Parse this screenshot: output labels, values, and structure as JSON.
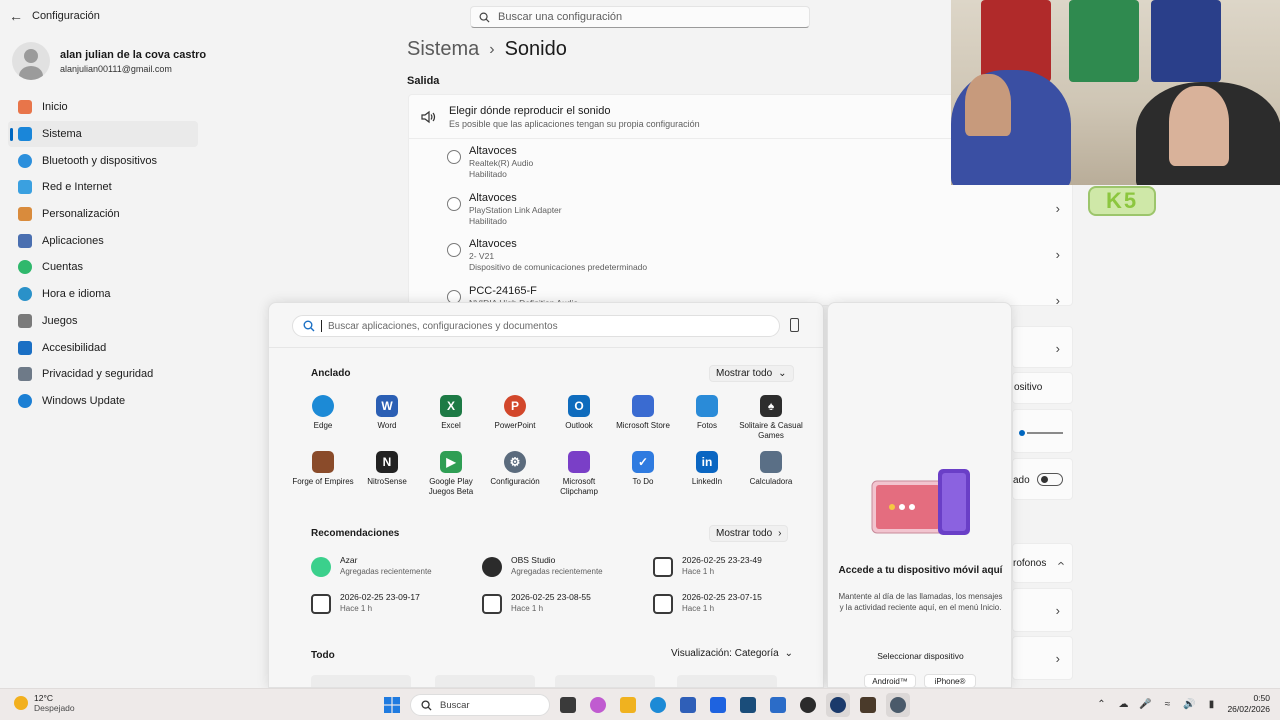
{
  "settings": {
    "app_title": "Configuración",
    "search_placeholder": "Buscar una configuración",
    "user": {
      "name": "alan julian de la cova castro",
      "email": "alanjulian00111@gmail.com"
    },
    "nav": [
      {
        "label": "Inicio",
        "icon": "home-icon",
        "color": "#e8754a"
      },
      {
        "label": "Sistema",
        "icon": "system-icon",
        "color": "#1a86d9"
      },
      {
        "label": "Bluetooth y dispositivos",
        "icon": "bluetooth-icon",
        "color": "#2b8fdc"
      },
      {
        "label": "Red e Internet",
        "icon": "network-icon",
        "color": "#3aa0e0"
      },
      {
        "label": "Personalización",
        "icon": "brush-icon",
        "color": "#d98b3c"
      },
      {
        "label": "Aplicaciones",
        "icon": "apps-icon",
        "color": "#4a6fb0"
      },
      {
        "label": "Cuentas",
        "icon": "account-icon",
        "color": "#2fb86c"
      },
      {
        "label": "Hora e idioma",
        "icon": "globe-icon",
        "color": "#2a91c9"
      },
      {
        "label": "Juegos",
        "icon": "gamepad-icon",
        "color": "#7a7a7a"
      },
      {
        "label": "Accesibilidad",
        "icon": "accessibility-icon",
        "color": "#1a6fc4"
      },
      {
        "label": "Privacidad y seguridad",
        "icon": "shield-icon",
        "color": "#6e7a88"
      },
      {
        "label": "Windows Update",
        "icon": "update-icon",
        "color": "#1b7fd4"
      }
    ],
    "breadcrumb": {
      "parent": "Sistema",
      "current": "Sonido"
    },
    "section": "Salida",
    "output": {
      "title": "Elegir dónde reproducir el sonido",
      "subtitle": "Es posible que las aplicaciones tengan su propia configuración",
      "devices": [
        {
          "name": "Altavoces",
          "line1": "Realtek(R) Audio",
          "line2": "Habilitado"
        },
        {
          "name": "Altavoces",
          "line1": "PlayStation Link Adapter",
          "line2": "Habilitado"
        },
        {
          "name": "Altavoces",
          "line1": "2- V21",
          "line2": "Dispositivo de comunicaciones predeterminado"
        },
        {
          "name": "PCC-24165-F",
          "line1": "NVIDIA High Definition Audio",
          "line2": ""
        }
      ]
    },
    "fragments": {
      "f1": "ositivo",
      "f2": "ado",
      "f3": "rofonos"
    }
  },
  "webcam_logo": "K5",
  "start_menu": {
    "search_placeholder": "Buscar aplicaciones, configuraciones y documentos",
    "pinned_title": "Anclado",
    "show_all": "Mostrar todo",
    "pinned": [
      {
        "label": "Edge",
        "color": "#1c8ad6"
      },
      {
        "label": "Word",
        "color": "#2b5fb4"
      },
      {
        "label": "Excel",
        "color": "#1d7a45"
      },
      {
        "label": "PowerPoint",
        "color": "#d2472b"
      },
      {
        "label": "Outlook",
        "color": "#0f6cbd"
      },
      {
        "label": "Microsoft Store",
        "color": "#3a6bd1"
      },
      {
        "label": "Fotos",
        "color": "#2a8bd8"
      },
      {
        "label": "Solitaire & Casual Games",
        "color": "#2d2d2d"
      },
      {
        "label": "Forge of Empires",
        "color": "#8a4b2a"
      },
      {
        "label": "NitroSense",
        "color": "#222222"
      },
      {
        "label": "Google Play Juegos Beta",
        "color": "#2f9e54"
      },
      {
        "label": "Configuración",
        "color": "#5b6b7d"
      },
      {
        "label": "Microsoft Clipchamp",
        "color": "#7a3fc7"
      },
      {
        "label": "To Do",
        "color": "#2f7be0"
      },
      {
        "label": "LinkedIn",
        "color": "#0a66c2"
      },
      {
        "label": "Calculadora",
        "color": "#5a6f86"
      }
    ],
    "recs_title": "Recomendaciones",
    "recs_show_all": "Mostrar todo",
    "recommendations": [
      {
        "name": "Azar",
        "sub": "Agregadas recientemente",
        "color": "#3bd08c"
      },
      {
        "name": "OBS Studio",
        "sub": "Agregadas recientemente",
        "color": "#2b2b2b"
      },
      {
        "name": "2026-02-25 23-23-49",
        "sub": "Hace 1 h",
        "color": "#3a3a3a"
      },
      {
        "name": "2026-02-25 23-09-17",
        "sub": "Hace 1 h",
        "color": "#3a3a3a"
      },
      {
        "name": "2026-02-25 23-08-55",
        "sub": "Hace 1 h",
        "color": "#3a3a3a"
      },
      {
        "name": "2026-02-25 23-07-15",
        "sub": "Hace 1 h",
        "color": "#3a3a3a"
      }
    ],
    "all_title": "Todo",
    "view_label": "Visualización: Categoría"
  },
  "phone_panel": {
    "title": "Accede a tu dispositivo móvil aquí",
    "description": "Mantente al día de las llamadas, los mensajes y la actividad reciente aquí, en el menú Inicio.",
    "select_label": "Seleccionar dispositivo",
    "android": "Android™",
    "iphone": "iPhone®"
  },
  "taskbar": {
    "weather_temp": "12°C",
    "weather_desc": "Despejado",
    "search_label": "Buscar",
    "apps": [
      {
        "icon": "windows-icon",
        "color": "#1f7be0"
      },
      {
        "icon": "task-view-icon",
        "color": "#3a3a3a"
      },
      {
        "icon": "copilot-icon",
        "color": "#c05bd0"
      },
      {
        "icon": "file-explorer-icon",
        "color": "#f0b21f"
      },
      {
        "icon": "edge-icon",
        "color": "#1c8ad6"
      },
      {
        "icon": "store-icon",
        "color": "#2f5fb8"
      },
      {
        "icon": "dropbox-icon",
        "color": "#1e63e0"
      },
      {
        "icon": "nitro-icon",
        "color": "#1a4d7a"
      },
      {
        "icon": "logi-icon",
        "color": "#2b6cc8"
      },
      {
        "icon": "obs-icon",
        "color": "#2b2b2b"
      },
      {
        "icon": "steam-icon",
        "color": "#1b3a6b"
      },
      {
        "icon": "game-icon",
        "color": "#4a3a2a"
      },
      {
        "icon": "settings-icon",
        "color": "#4a5a6a"
      }
    ],
    "time": "0:50",
    "date": "26/02/2026"
  }
}
